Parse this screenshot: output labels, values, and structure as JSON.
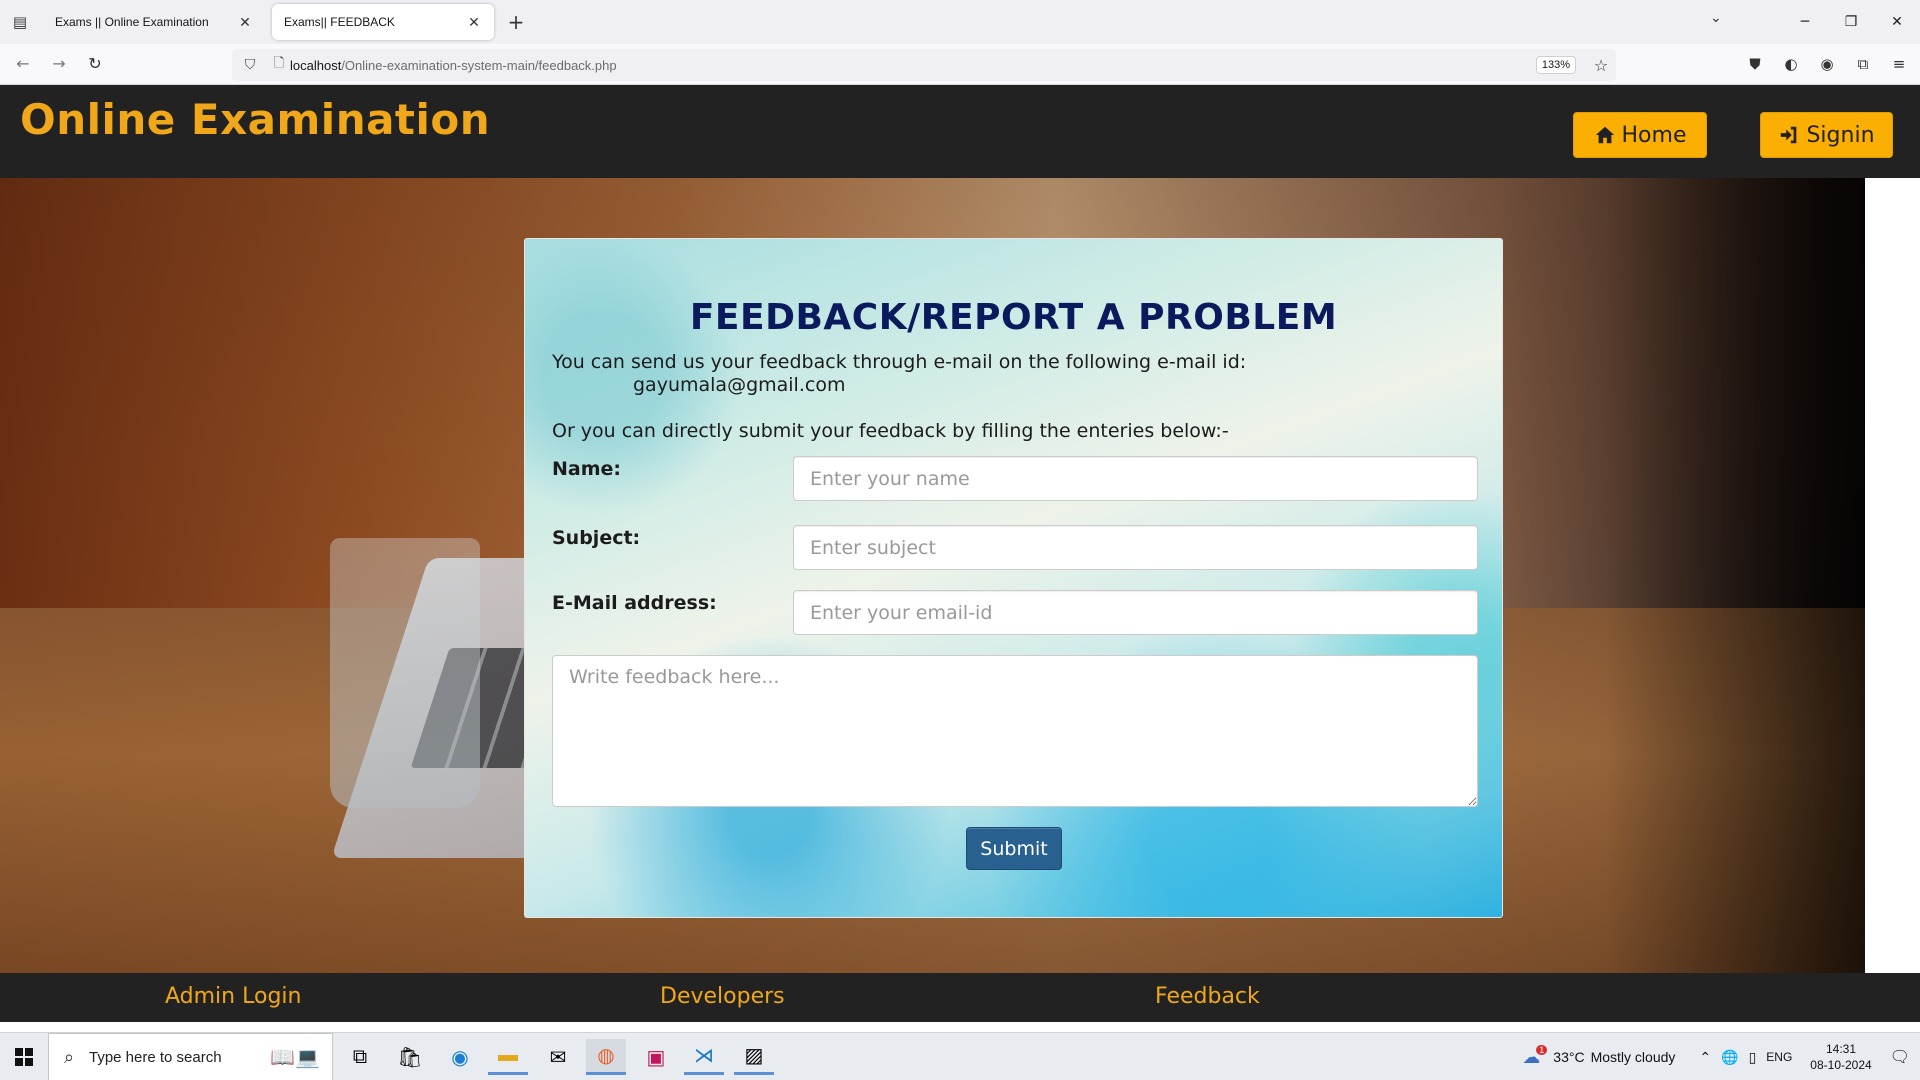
{
  "browser": {
    "tabs": [
      {
        "title": "Exams || Online Examination",
        "active": false
      },
      {
        "title": "Exams|| FEEDBACK",
        "active": true
      }
    ],
    "url_host": "localhost",
    "url_path": "/Online-examination-system-main/feedback.php",
    "zoom": "133%"
  },
  "header": {
    "site_title": "Online Examination",
    "home_label": "Home",
    "signin_label": "Signin"
  },
  "feedback": {
    "title": "FEEDBACK/REPORT A PROBLEM",
    "intro": "You can send us your feedback through e-mail on the following e-mail id:",
    "email": "gayumala@gmail.com",
    "direct_text": "Or you can directly submit your feedback by filling the enteries below:-",
    "name_label": "Name:",
    "name_placeholder": "Enter your name",
    "subject_label": "Subject:",
    "subject_placeholder": "Enter subject",
    "email_label": "E-Mail address:",
    "email_placeholder": "Enter your email-id",
    "feedback_placeholder": "Write feedback here...",
    "submit_label": "Submit"
  },
  "footer": {
    "links": [
      "Admin Login",
      "Developers",
      "Feedback"
    ]
  },
  "taskbar": {
    "search_placeholder": "Type here to search",
    "temperature": "33°C",
    "weather": "Mostly cloudy",
    "language": "ENG",
    "time": "14:31",
    "date": "08-10-2024",
    "notification_count": "1"
  },
  "colors": {
    "brand_orange": "#f0a81a",
    "button_yellow": "#fcaf03",
    "header_dark": "#222222",
    "title_navy": "#0a1a5c",
    "submit_blue": "#286090"
  }
}
